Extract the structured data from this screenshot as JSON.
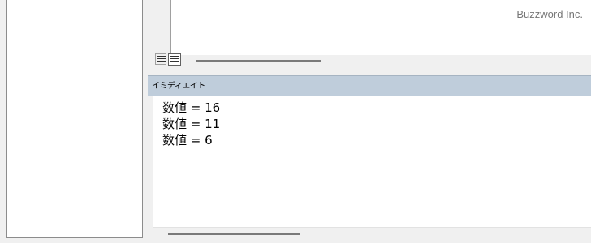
{
  "watermark": "Buzzword Inc.",
  "immediate_window": {
    "title": "イミディエイト",
    "lines": [
      "数値 = 16",
      "数値 = 11",
      "数値 = 6"
    ]
  },
  "icons": {
    "procedure_view": "procedure-view-icon",
    "full_module_view": "full-module-view-icon"
  }
}
